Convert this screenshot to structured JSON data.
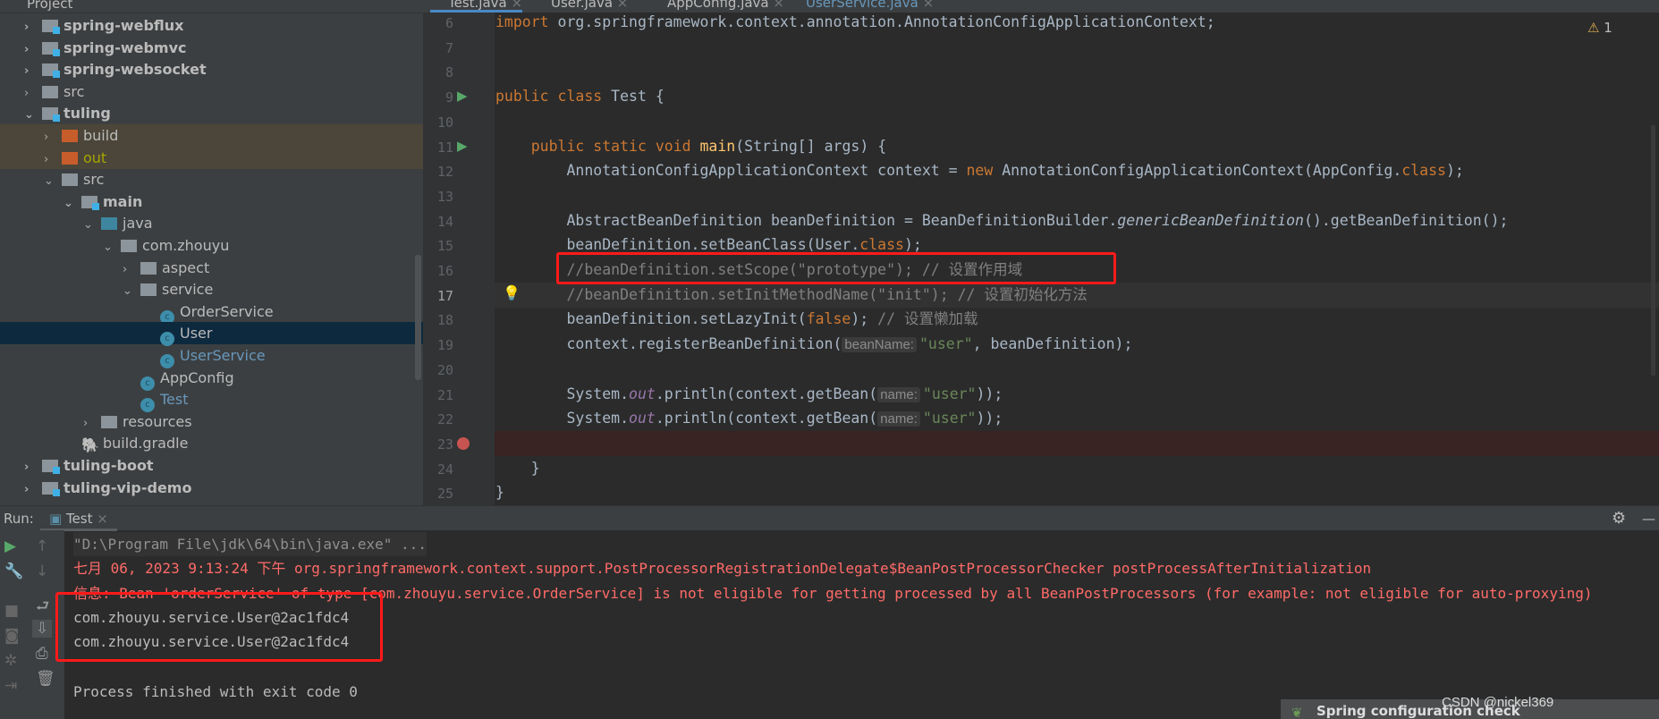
{
  "project_panel": {
    "title": "Project",
    "items": [
      {
        "label": "spring-webflux",
        "depth": 0,
        "expanded": false,
        "icon": "module-folder",
        "bold": true
      },
      {
        "label": "spring-webmvc",
        "depth": 0,
        "expanded": false,
        "icon": "module-folder",
        "bold": true
      },
      {
        "label": "spring-websocket",
        "depth": 0,
        "expanded": false,
        "icon": "module-folder",
        "bold": true
      },
      {
        "label": "src",
        "depth": 0,
        "expanded": false,
        "icon": "folder"
      },
      {
        "label": "tuling",
        "depth": 0,
        "expanded": true,
        "icon": "module-folder",
        "bold": true
      },
      {
        "label": "build",
        "depth": 1,
        "expanded": false,
        "icon": "excluded-folder",
        "excluded": true
      },
      {
        "label": "out",
        "depth": 1,
        "expanded": false,
        "icon": "excluded-folder",
        "excluded": true,
        "color": "#a6a600"
      },
      {
        "label": "src",
        "depth": 1,
        "expanded": true,
        "icon": "folder"
      },
      {
        "label": "main",
        "depth": 2,
        "expanded": true,
        "icon": "module-folder",
        "bold": true
      },
      {
        "label": "java",
        "depth": 3,
        "expanded": true,
        "icon": "source-folder"
      },
      {
        "label": "com.zhouyu",
        "depth": 4,
        "expanded": true,
        "icon": "package"
      },
      {
        "label": "aspect",
        "depth": 5,
        "expanded": false,
        "icon": "package"
      },
      {
        "label": "service",
        "depth": 5,
        "expanded": true,
        "icon": "package"
      },
      {
        "label": "OrderService",
        "depth": 6,
        "icon": "class"
      },
      {
        "label": "User",
        "depth": 6,
        "icon": "class",
        "selected": true
      },
      {
        "label": "UserService",
        "depth": 6,
        "icon": "class",
        "color": "#6897bb"
      },
      {
        "label": "AppConfig",
        "depth": 5,
        "icon": "class"
      },
      {
        "label": "Test",
        "depth": 5,
        "icon": "class-runnable",
        "color": "#6897bb"
      },
      {
        "label": "resources",
        "depth": 3,
        "expanded": false,
        "icon": "resources-folder"
      },
      {
        "label": "build.gradle",
        "depth": 2,
        "icon": "gradle"
      },
      {
        "label": "tuling-boot",
        "depth": 0,
        "expanded": false,
        "icon": "module-folder",
        "bold": true
      },
      {
        "label": "tuling-vip-demo",
        "depth": 0,
        "expanded": false,
        "icon": "module-folder",
        "bold": true
      }
    ]
  },
  "editor_tabs": [
    {
      "label": "Test.java",
      "active": true
    },
    {
      "label": "User.java"
    },
    {
      "label": "AppConfig.java"
    },
    {
      "label": "UserService.java",
      "modified": true
    }
  ],
  "editor": {
    "warning_count": "1",
    "lines": [
      {
        "n": "6",
        "html": "<span class='kw'>import</span> org.springframework.context.annotation.AnnotationConfigApplicationContext;"
      },
      {
        "n": "7",
        "html": ""
      },
      {
        "n": "8",
        "html": ""
      },
      {
        "n": "9",
        "html": "<span class='kw'>public class</span> Test {",
        "run": true
      },
      {
        "n": "10",
        "html": ""
      },
      {
        "n": "11",
        "html": "    <span class='kw'>public static void</span> <span class='fn'>main</span>(String[] args) {",
        "run": true
      },
      {
        "n": "12",
        "html": "        AnnotationConfigApplicationContext context = <span class='kw'>new</span> AnnotationConfigApplicationContext(AppConfig.<span class='kw'>class</span>);"
      },
      {
        "n": "13",
        "html": ""
      },
      {
        "n": "14",
        "html": "        AbstractBeanDefinition beanDefinition = BeanDefinitionBuilder.<span class='it'>genericBeanDefinition</span>().getBeanDefinition();"
      },
      {
        "n": "15",
        "html": "        beanDefinition.setBeanClass(User.<span class='kw'>class</span>);"
      },
      {
        "n": "16",
        "html": "        <span class='cm'>//beanDefinition.setScope(\"prototype\"); // 设置作用域</span>"
      },
      {
        "n": "17",
        "html": "        <span class='cm'>//beanDefinition.setInitMethodName(\"init\"); // 设置初始化方法</span>",
        "current": true
      },
      {
        "n": "18",
        "html": "        beanDefinition.setLazyInit(<span class='kw'>false</span>); <span class='cm'>// 设置懒加载</span>"
      },
      {
        "n": "19",
        "html": "        context.registerBeanDefinition(<span class='hint'>beanName:</span><span class='str'>\"user\"</span>, beanDefinition);"
      },
      {
        "n": "20",
        "html": ""
      },
      {
        "n": "21",
        "html": "        System.<span class='fld'>out</span>.println(context.getBean(<span class='hint'>name:</span><span class='str'>\"user\"</span>));"
      },
      {
        "n": "22",
        "html": "        System.<span class='fld'>out</span>.println(context.getBean(<span class='hint'>name:</span><span class='str'>\"user\"</span>));"
      },
      {
        "n": "23",
        "html": "",
        "breakpoint": true
      },
      {
        "n": "24",
        "html": "    }"
      },
      {
        "n": "25",
        "html": "}"
      }
    ]
  },
  "run_panel": {
    "label": "Run:",
    "tab": "Test",
    "console": [
      {
        "text": "\"D:\\Program File\\jdk\\64\\bin\\java.exe\" ...",
        "kind": "cmd"
      },
      {
        "text": "七月 06, 2023 9:13:24 下午 org.springframework.context.support.PostProcessorRegistrationDelegate$BeanPostProcessorChecker postProcessAfterInitialization",
        "kind": "err"
      },
      {
        "text": "信息: Bean 'orderService' of type [com.zhouyu.service.OrderService] is not eligible for getting processed by all BeanPostProcessors (for example: not eligible for auto-proxying)",
        "kind": "err"
      },
      {
        "text": "com.zhouyu.service.User@2ac1fdc4",
        "kind": "ok"
      },
      {
        "text": "com.zhouyu.service.User@2ac1fdc4",
        "kind": "ok"
      },
      {
        "text": "",
        "kind": "ok"
      },
      {
        "text": "Process finished with exit code 0",
        "kind": "ok"
      }
    ]
  },
  "notification": {
    "title": "Spring configuration check"
  },
  "watermark": "CSDN @nickel369",
  "colors": {
    "highlight_box": "#ff1a1a",
    "error_text": "#ff6b68",
    "accent": "#4a88c7"
  }
}
